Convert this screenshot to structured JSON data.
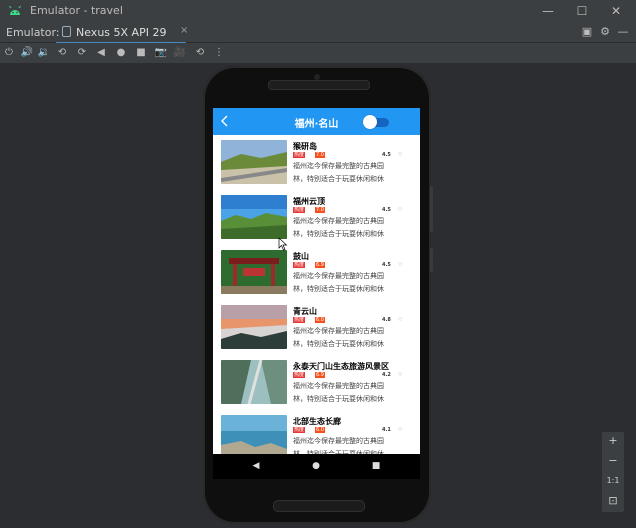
{
  "window": {
    "title": "Emulator - travel"
  },
  "tabbar": {
    "label": "Emulator:",
    "tab_title": "Nexus 5X API 29",
    "tab_close": "×"
  },
  "app": {
    "title": "福州·名山",
    "accent": "#2196f3",
    "toggle_on": false,
    "items": [
      {
        "name": "猴研岛",
        "tag1": "热度",
        "tag2": "7.0",
        "score": "4.5",
        "desc1": "福州迄今保存最完整的古典园",
        "desc2": "林，特别适合于玩耍休闲和休",
        "thumb": "coastal-road"
      },
      {
        "name": "福州云顶",
        "tag1": "热度",
        "tag2": "7.0",
        "score": "4.5",
        "desc1": "福州迄今保存最完整的古典园",
        "desc2": "林，特别适合于玩耍休闲和休",
        "thumb": "mountain-sky"
      },
      {
        "name": "鼓山",
        "tag1": "热度",
        "tag2": "6.9",
        "score": "4.5",
        "desc1": "福州迄今保存最完整的古典园",
        "desc2": "林，特别适合于玩耍休闲和休",
        "thumb": "temple-gate"
      },
      {
        "name": "青云山",
        "tag1": "热度",
        "tag2": "6.0",
        "score": "4.8",
        "desc1": "福州迄今保存最完整的古典园",
        "desc2": "林，特别适合于玩耍休闲和休",
        "thumb": "cloud-sea"
      },
      {
        "name": "永泰天门山生态旅游风景区",
        "tag1": "热度",
        "tag2": "6.9",
        "score": "4.2",
        "desc1": "福州迄今保存最完整的古典园",
        "desc2": "林，特别适合于玩耍休闲和休",
        "thumb": "glass-walkway"
      },
      {
        "name": "北部生态长廊",
        "tag1": "热度",
        "tag2": "6.0",
        "score": "4.1",
        "desc1": "福州迄今保存最完整的古典园",
        "desc2": "林，特别适合于玩耍休闲和休",
        "thumb": "coast-rocks"
      }
    ]
  },
  "zoom": {
    "in": "+",
    "out": "−",
    "ratio": "1:1"
  }
}
